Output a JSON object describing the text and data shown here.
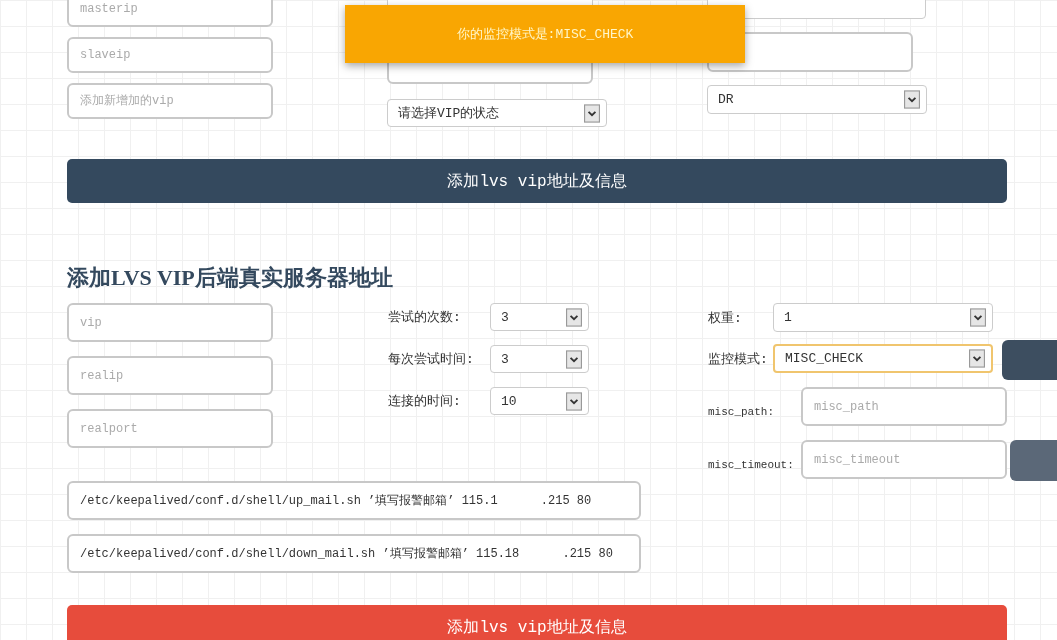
{
  "notification": {
    "text": "你的监控模式是:MISC_CHECK"
  },
  "vip_form": {
    "fields": [
      {
        "placeholder": "masterip"
      },
      {
        "placeholder": "slaveip"
      },
      {
        "placeholder": "添加新增加的vip"
      }
    ],
    "status_select": {
      "value": "请选择VIP的状态"
    },
    "lb_kind_select": {
      "value": "DR"
    },
    "submit_button": "添加lvs vip地址及信息"
  },
  "realserver_form": {
    "title": "添加LVS VIP后端真实服务器地址",
    "fields": [
      {
        "placeholder": "vip"
      },
      {
        "placeholder": "realip"
      },
      {
        "placeholder": "realport"
      }
    ],
    "retry_settings": [
      {
        "label": "尝试的次数:",
        "value": "3"
      },
      {
        "label": "每次尝试时间:",
        "value": "3"
      },
      {
        "label": "连接的时间:",
        "value": "10"
      }
    ],
    "weight": {
      "label": "权重:",
      "value": "1",
      "focused": false
    },
    "monitor_mode": {
      "label": "监控模式:",
      "value": "MISC_CHECK",
      "focused": true
    },
    "misc_fields": [
      {
        "label": "misc_path:",
        "placeholder": "misc_path"
      },
      {
        "label": "misc_timeout:",
        "placeholder": "misc_timeout"
      }
    ],
    "scripts": [
      {
        "value": "/etc/keepalived/conf.d/shell/up_mail.sh ’填写报警邮箱’ 115.1      .215 80"
      },
      {
        "value": "/etc/keepalived/conf.d/shell/down_mail.sh ’填写报警邮箱’ 115.18      .215 80"
      }
    ],
    "submit_button": "添加lvs vip地址及信息"
  }
}
